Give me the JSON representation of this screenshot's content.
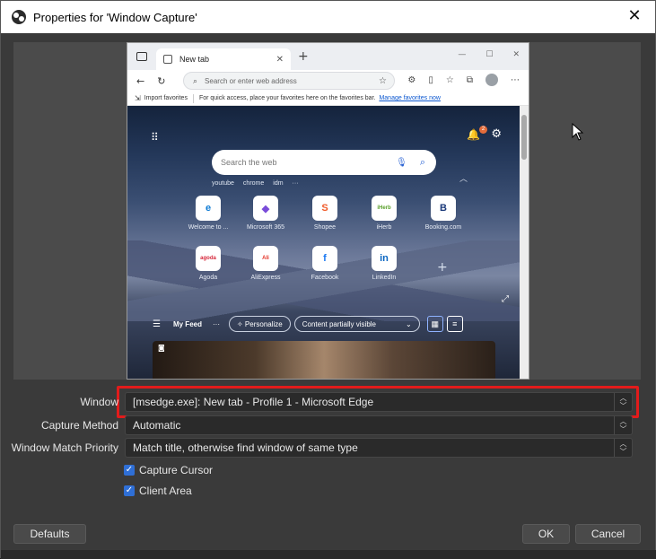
{
  "window": {
    "title": "Properties for 'Window Capture'"
  },
  "browser_preview": {
    "tab_title": "New tab",
    "address_placeholder": "Search or enter web address",
    "favorites_import": "Import favorites",
    "favorites_hint": "For quick access, place your favorites here on the favorites bar.",
    "favorites_link": "Manage favorites now",
    "search_placeholder": "Search the web",
    "notification_count": "2",
    "quick_chips": [
      "youtube",
      "chrome",
      "idm",
      "···"
    ],
    "tiles": [
      {
        "label": "Welcome to ...",
        "glyph": "e",
        "color": "#0f7bd4"
      },
      {
        "label": "Microsoft 365",
        "glyph": "◆",
        "color": "#7a4cd9"
      },
      {
        "label": "Shopee",
        "glyph": "S",
        "color": "#f05a28"
      },
      {
        "label": "iHerb",
        "glyph": "iHerb",
        "color": "#5aa02c"
      },
      {
        "label": "Booking.com",
        "glyph": "B",
        "color": "#1b3a7a"
      },
      {
        "label": "Agoda",
        "glyph": "agoda",
        "color": "#d6283b"
      },
      {
        "label": "AliExpress",
        "glyph": "Ali",
        "color": "#e43225"
      },
      {
        "label": "Facebook",
        "glyph": "f",
        "color": "#1877f2"
      },
      {
        "label": "LinkedIn",
        "glyph": "in",
        "color": "#0a66c2"
      }
    ],
    "feed": {
      "my_feed": "My Feed",
      "more": "···",
      "personalize": "Personalize",
      "visibility": "Content partially visible"
    }
  },
  "form": {
    "window_label": "Window",
    "window_value": "[msedge.exe]: New tab - Profile 1 - Microsoft Edge",
    "capture_method_label": "Capture Method",
    "capture_method_value": "Automatic",
    "match_priority_label": "Window Match Priority",
    "match_priority_value": "Match title, otherwise find window of same type",
    "capture_cursor_label": "Capture Cursor",
    "capture_cursor_checked": true,
    "client_area_label": "Client Area",
    "client_area_checked": true
  },
  "buttons": {
    "defaults": "Defaults",
    "ok": "OK",
    "cancel": "Cancel"
  },
  "colors": {
    "highlight": "#e21b1b",
    "checkbox": "#2f6fd6",
    "dialog_bg": "#3a3a3a"
  }
}
